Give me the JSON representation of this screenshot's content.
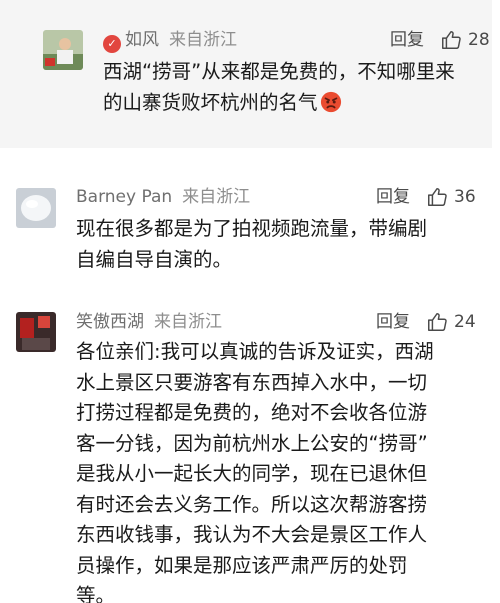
{
  "comments": [
    {
      "username": "如风",
      "location": "来自浙江",
      "reply_label": "回复",
      "like_count": "28",
      "text_lines": [
        "西湖“捞哥”从来都是免费的，不知哪里来",
        "的山寨货败坏杭州的名气"
      ],
      "emoji": "angry-face"
    },
    {
      "username": "Barney Pan",
      "location": "来自浙江",
      "reply_label": "回复",
      "like_count": "36",
      "text_lines": [
        "现在很多都是为了拍视频跑流量，带编剧",
        "自编自导自演的。"
      ]
    },
    {
      "username": "笑傲西湖",
      "location": "来自浙江",
      "reply_label": "回复",
      "like_count": "24",
      "text_lines": [
        "各位亲们:我可以真诚的告诉及证实，西湖",
        "水上景区只要游客有东西掉入水中，一切",
        "打捞过程都是免费的，绝对不会收各位游",
        "客一分钱，因为前杭州水上公安的“捞哥”",
        "是我从小一起长大的同学，现在已退休但",
        "有时还会去义务工作。所以这次帮游客捞",
        "东西收钱事，我认为不大会是景区工作人",
        "员操作，如果是那应该严肃严厉的处罚",
        "等。"
      ]
    }
  ],
  "colors": {
    "meta": "#6f6f6f",
    "text": "#1a1a1a",
    "panel_gray": "#f5f5f5",
    "verified_badge": "#e2463f"
  }
}
